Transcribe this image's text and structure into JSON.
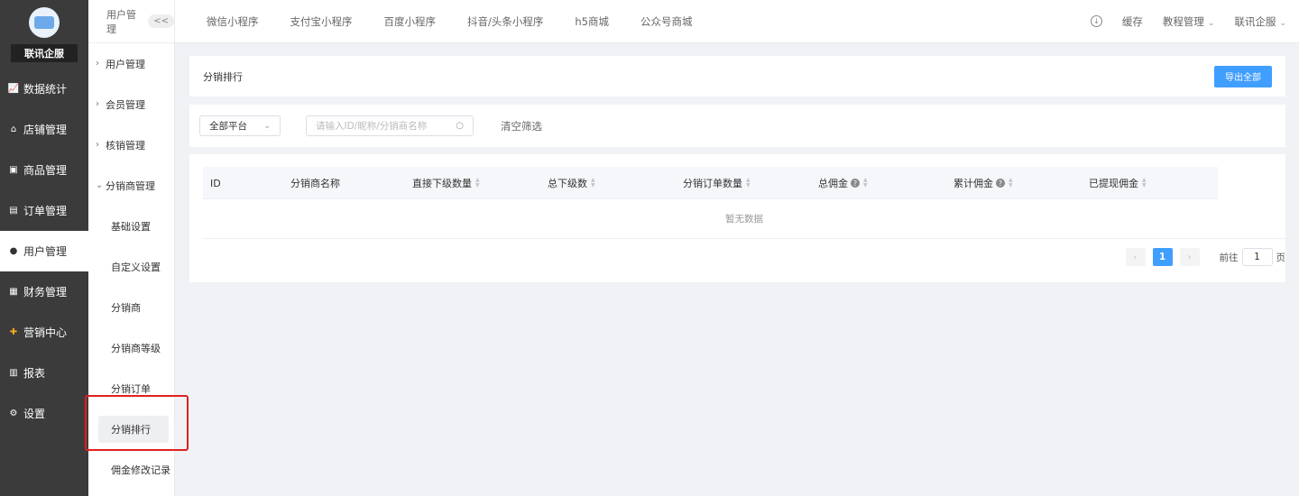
{
  "brand": {
    "name": "联讯企服"
  },
  "sidebar": {
    "items": [
      {
        "label": "数据统计",
        "icon": "chart-line-icon"
      },
      {
        "label": "店铺管理",
        "icon": "store-icon"
      },
      {
        "label": "商品管理",
        "icon": "goods-icon"
      },
      {
        "label": "订单管理",
        "icon": "order-icon"
      },
      {
        "label": "用户管理",
        "icon": "user-icon"
      },
      {
        "label": "财务管理",
        "icon": "finance-icon"
      },
      {
        "label": "营销中心",
        "icon": "marketing-icon"
      },
      {
        "label": "报表",
        "icon": "report-icon"
      },
      {
        "label": "设置",
        "icon": "gear-icon"
      }
    ],
    "active": "用户管理"
  },
  "subnav": {
    "title": "用户管理",
    "collapse": "<<",
    "groups": [
      "用户管理",
      "会员管理",
      "核销管理",
      "分销商管理"
    ],
    "children": [
      "基础设置",
      "自定义设置",
      "分销商",
      "分销商等级",
      "分销订单",
      "分销排行",
      "佣金修改记录"
    ],
    "selected": "分销排行"
  },
  "topnav": {
    "tabs": [
      "微信小程序",
      "支付宝小程序",
      "百度小程序",
      "抖音/头条小程序",
      "h5商城",
      "公众号商城"
    ],
    "cache": "缓存",
    "tutorial": "教程管理",
    "account": "联讯企服"
  },
  "page": {
    "title": "分销排行",
    "export": "导出全部"
  },
  "filter": {
    "platform": "全部平台",
    "search_placeholder": "请输入ID/昵称/分销商名称",
    "clear": "清空筛选"
  },
  "table": {
    "columns": [
      "ID",
      "分销商名称",
      "直接下级数量",
      "总下级数",
      "分销订单数量",
      "总佣金",
      "累计佣金",
      "已提现佣金"
    ],
    "empty": "暂无数据"
  },
  "pagination": {
    "current": "1",
    "goto_label": "前往",
    "goto_value": "1",
    "page_suffix": "页"
  },
  "colors": {
    "primary": "#409eff",
    "sidebar": "#3b3b3b",
    "highlight": "#e02020"
  }
}
